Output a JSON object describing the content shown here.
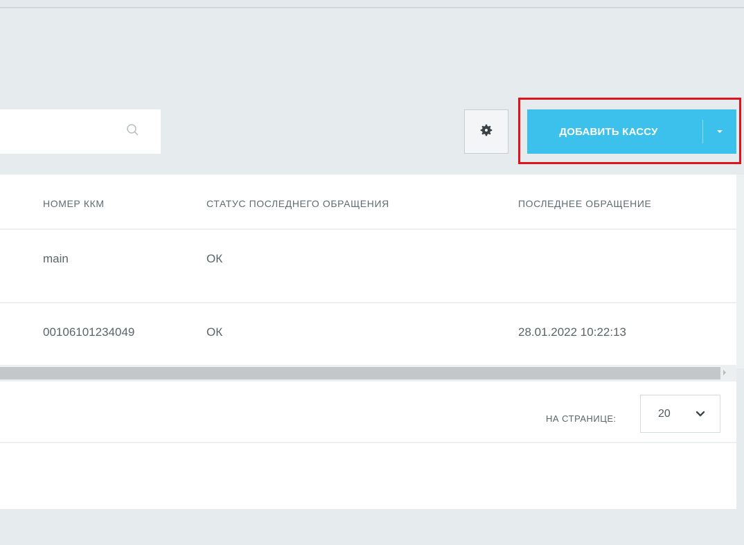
{
  "search": {
    "placeholder": ""
  },
  "toolbar": {
    "add_label": "ДОБАВИТЬ КАССУ",
    "settings_icon": "gear-icon",
    "caret_icon": "caret-down-icon"
  },
  "table": {
    "columns": [
      "НОМЕР ККМ",
      "СТАТУС ПОСЛЕДНЕГО ОБРАЩЕНИЯ",
      "ПОСЛЕДНЕЕ ОБРАЩЕНИЕ"
    ],
    "rows": [
      {
        "kkm": "main",
        "status": "ОК",
        "last": ""
      },
      {
        "kkm": "00106101234049",
        "status": "ОК",
        "last": "28.01.2022 10:22:13"
      }
    ]
  },
  "pagination": {
    "label": "НА СТРАНИЦЕ:",
    "page_size": "20"
  },
  "colors": {
    "accent": "#3cc0ec",
    "highlight": "#e0121c"
  }
}
